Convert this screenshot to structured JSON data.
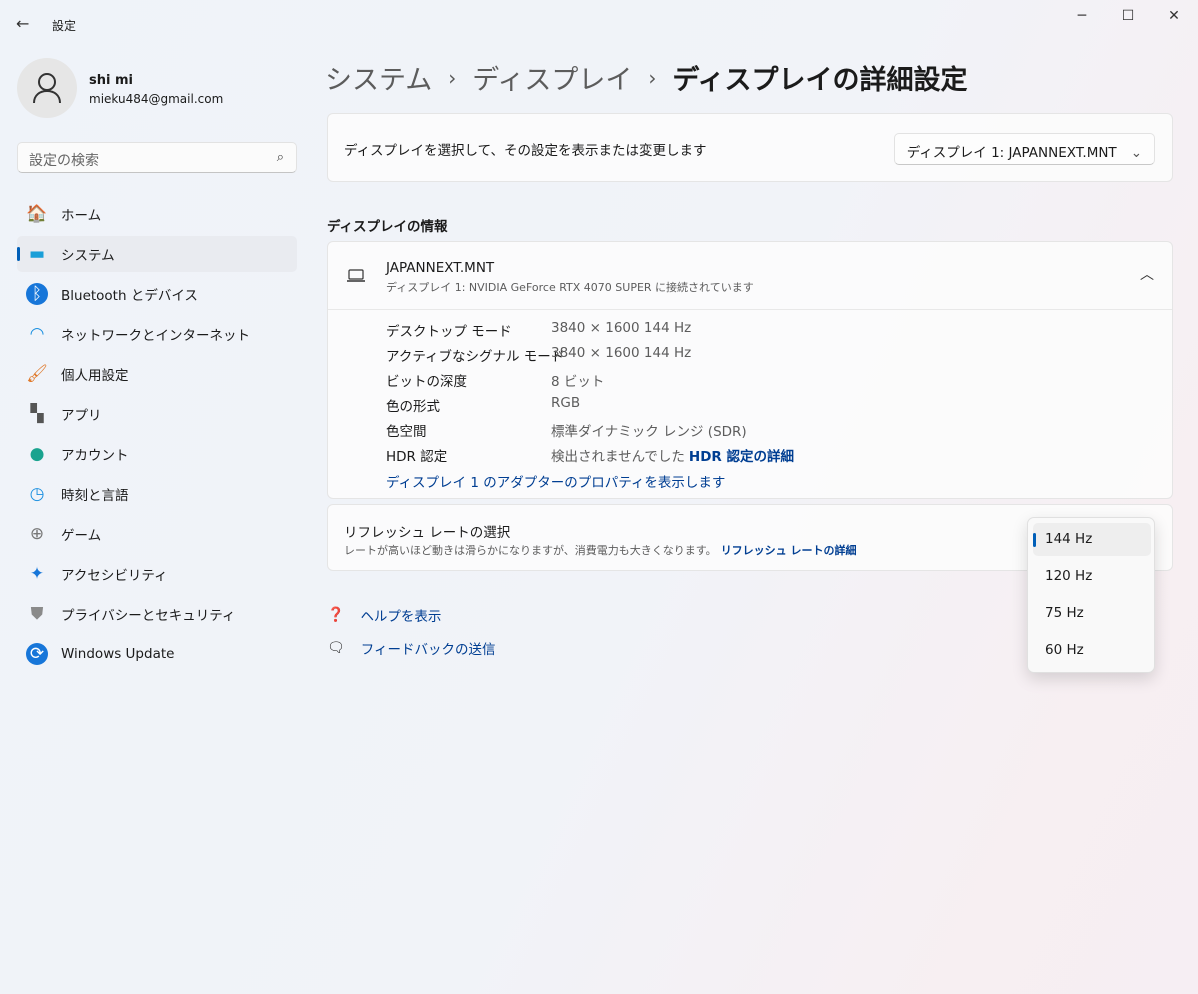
{
  "window": {
    "title": "設定",
    "back_icon": "arrow-left",
    "minimize": "─",
    "maximize": "☐",
    "close": "✕"
  },
  "user": {
    "name": "shi mi",
    "email": "mieku484@gmail.com"
  },
  "search": {
    "placeholder": "設定の検索"
  },
  "nav": [
    {
      "label": "ホーム",
      "icon": "home"
    },
    {
      "label": "システム",
      "icon": "system",
      "selected": true
    },
    {
      "label": "Bluetooth とデバイス",
      "icon": "bluetooth"
    },
    {
      "label": "ネットワークとインターネット",
      "icon": "wifi"
    },
    {
      "label": "個人用設定",
      "icon": "brush"
    },
    {
      "label": "アプリ",
      "icon": "apps"
    },
    {
      "label": "アカウント",
      "icon": "account"
    },
    {
      "label": "時刻と言語",
      "icon": "time-language"
    },
    {
      "label": "ゲーム",
      "icon": "gamepad"
    },
    {
      "label": "アクセシビリティ",
      "icon": "accessibility"
    },
    {
      "label": "プライバシーとセキュリティ",
      "icon": "shield"
    },
    {
      "label": "Windows Update",
      "icon": "update"
    }
  ],
  "breadcrumb": [
    "システム",
    "ディスプレイ",
    "ディスプレイの詳細設定"
  ],
  "select_card": {
    "text": "ディスプレイを選択して、その設定を表示または変更します",
    "dropdown": "ディスプレイ 1: JAPANNEXT.MNT"
  },
  "info_section": {
    "title": "ディスプレイの情報",
    "monitor": "JAPANNEXT.MNT",
    "subtitle": "ディスプレイ 1: NVIDIA GeForce RTX 4070 SUPER に接続されています",
    "rows": [
      {
        "label": "デスクトップ モード",
        "value": "3840 × 1600 144 Hz"
      },
      {
        "label": "アクティブなシグナル モード",
        "value": "3840 × 1600 144 Hz"
      },
      {
        "label": "ビットの深度",
        "value": "8 ビット"
      },
      {
        "label": "色の形式",
        "value": "RGB"
      },
      {
        "label": "色空間",
        "value": "標準ダイナミック レンジ (SDR)"
      },
      {
        "label": "HDR 認定",
        "value": "検出されませんでした",
        "link": "HDR 認定の詳細"
      }
    ],
    "adapter_link": "ディスプレイ 1 のアダプターのプロパティを表示します"
  },
  "refresh": {
    "title": "リフレッシュ レートの選択",
    "desc": "レートが高いほど動きは滑らかになりますが、消費電力も大きくなります。",
    "link": "リフレッシュ レートの詳細",
    "options": [
      "144 Hz",
      "120 Hz",
      "75 Hz",
      "60 Hz"
    ],
    "selected": "144 Hz"
  },
  "help": {
    "help": "ヘルプを表示",
    "feedback": "フィードバックの送信"
  }
}
